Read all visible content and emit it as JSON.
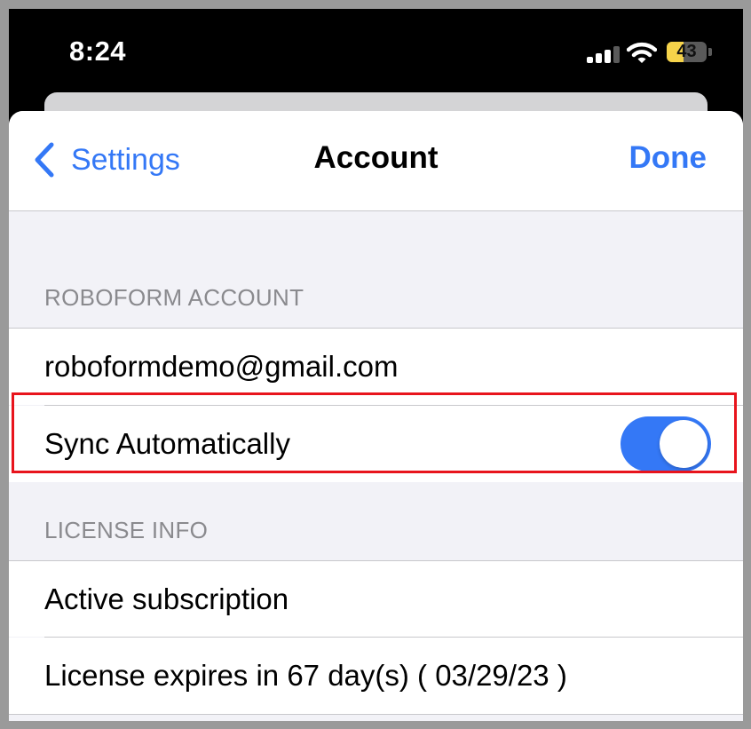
{
  "status_bar": {
    "time": "8:24",
    "battery": 43,
    "battery_label": "43",
    "signal_bars": 4,
    "signal_bars_active": 3,
    "icons": [
      "cellular-signal-icon",
      "wifi-icon",
      "battery-icon"
    ],
    "colors": {
      "battery_fill": "#f6d34a",
      "signal_active": "#ffffff",
      "signal_inactive": "#5a5a5a"
    }
  },
  "nav": {
    "back_label": "Settings",
    "back_icon": "chevron-left-icon",
    "title": "Account",
    "done_label": "Done"
  },
  "sections": [
    {
      "header": "ROBOFORM ACCOUNT",
      "rows": [
        {
          "label": "roboformdemo@gmail.com"
        },
        {
          "label": "Sync Automatically",
          "toggle": true
        }
      ]
    },
    {
      "header": "LICENSE INFO",
      "rows": [
        {
          "label": "Active subscription"
        },
        {
          "label": "License expires in 67 day(s) ( 03/29/23 )"
        }
      ]
    }
  ],
  "colors": {
    "accent": "#3478f6",
    "highlight": "#e8141c",
    "group_background": "#f2f2f7"
  }
}
